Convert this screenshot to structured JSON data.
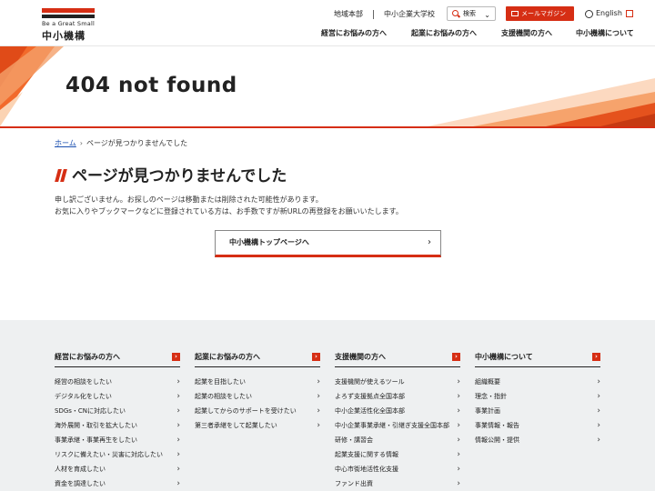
{
  "header": {
    "logo_tagline": "Be a Great Small",
    "logo_name": "中小機構",
    "util_links": [
      "地域本部",
      "中小企業大学校"
    ],
    "search_label": "検索",
    "mail_label": "メールマガジン",
    "lang_label": "English",
    "nav": [
      "経営にお悩みの方へ",
      "起業にお悩みの方へ",
      "支援機関の方へ",
      "中小機構について"
    ]
  },
  "hero": {
    "title": "404 not found"
  },
  "breadcrumb": {
    "home": "ホーム",
    "current": "ページが見つかりませんでした"
  },
  "main": {
    "heading": "ページが見つかりませんでした",
    "line1": "申し訳ございません。お探しのページは移動または削除された可能性があります。",
    "line2": "お気に入りやブックマークなどに登録されている方は、お手数ですが新URLの再登録をお願いいたします。",
    "button": "中小機構トップページへ"
  },
  "footer": {
    "columns": [
      {
        "title": "経営にお悩みの方へ",
        "items": [
          "経営の相談をしたい",
          "デジタル化をしたい",
          "SDGs・CNに対応したい",
          "海外展開・取引を拡大したい",
          "事業承継・事業再生をしたい",
          "リスクに備えたい・災害に対応したい",
          "人材を育成したい",
          "資金を調達したい"
        ]
      },
      {
        "title": "起業にお悩みの方へ",
        "items": [
          "起業を目指したい",
          "起業の相談をしたい",
          "起業してからのサポートを受けたい",
          "第三者承継をして起業したい"
        ]
      },
      {
        "title": "支援機関の方へ",
        "items": [
          "支援機関が使えるツール",
          "よろず支援拠点全国本部",
          "中小企業活性化全国本部",
          "中小企業事業承継・引継ぎ支援全国本部",
          "研修・講習会",
          "起業支援に関する情報",
          "中心市街地活性化支援",
          "ファンド出資"
        ]
      },
      {
        "title": "中小機構について",
        "items": [
          "組織概要",
          "理念・指針",
          "事業計画",
          "事業情報・報告",
          "情報公開・提供"
        ]
      }
    ]
  },
  "colors": {
    "brand_red": "#d62e14",
    "footer_bg": "#eef0f1"
  }
}
